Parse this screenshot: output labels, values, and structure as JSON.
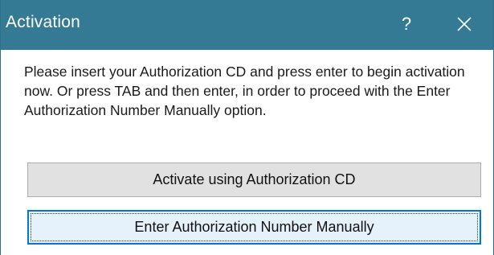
{
  "window": {
    "title": "Activation",
    "help_glyph": "?",
    "close_icon": "close-icon",
    "titlebar_color": "#357a95"
  },
  "message": {
    "text": "Please insert your Authorization CD and press enter to begin activation now. Or press TAB and then enter, in order to proceed with the Enter Authorization Number Manually option."
  },
  "buttons": {
    "activate_cd_label": "Activate using Authorization CD",
    "manual_label": "Enter Authorization Number Manually",
    "focus_color": "#0078d7"
  }
}
